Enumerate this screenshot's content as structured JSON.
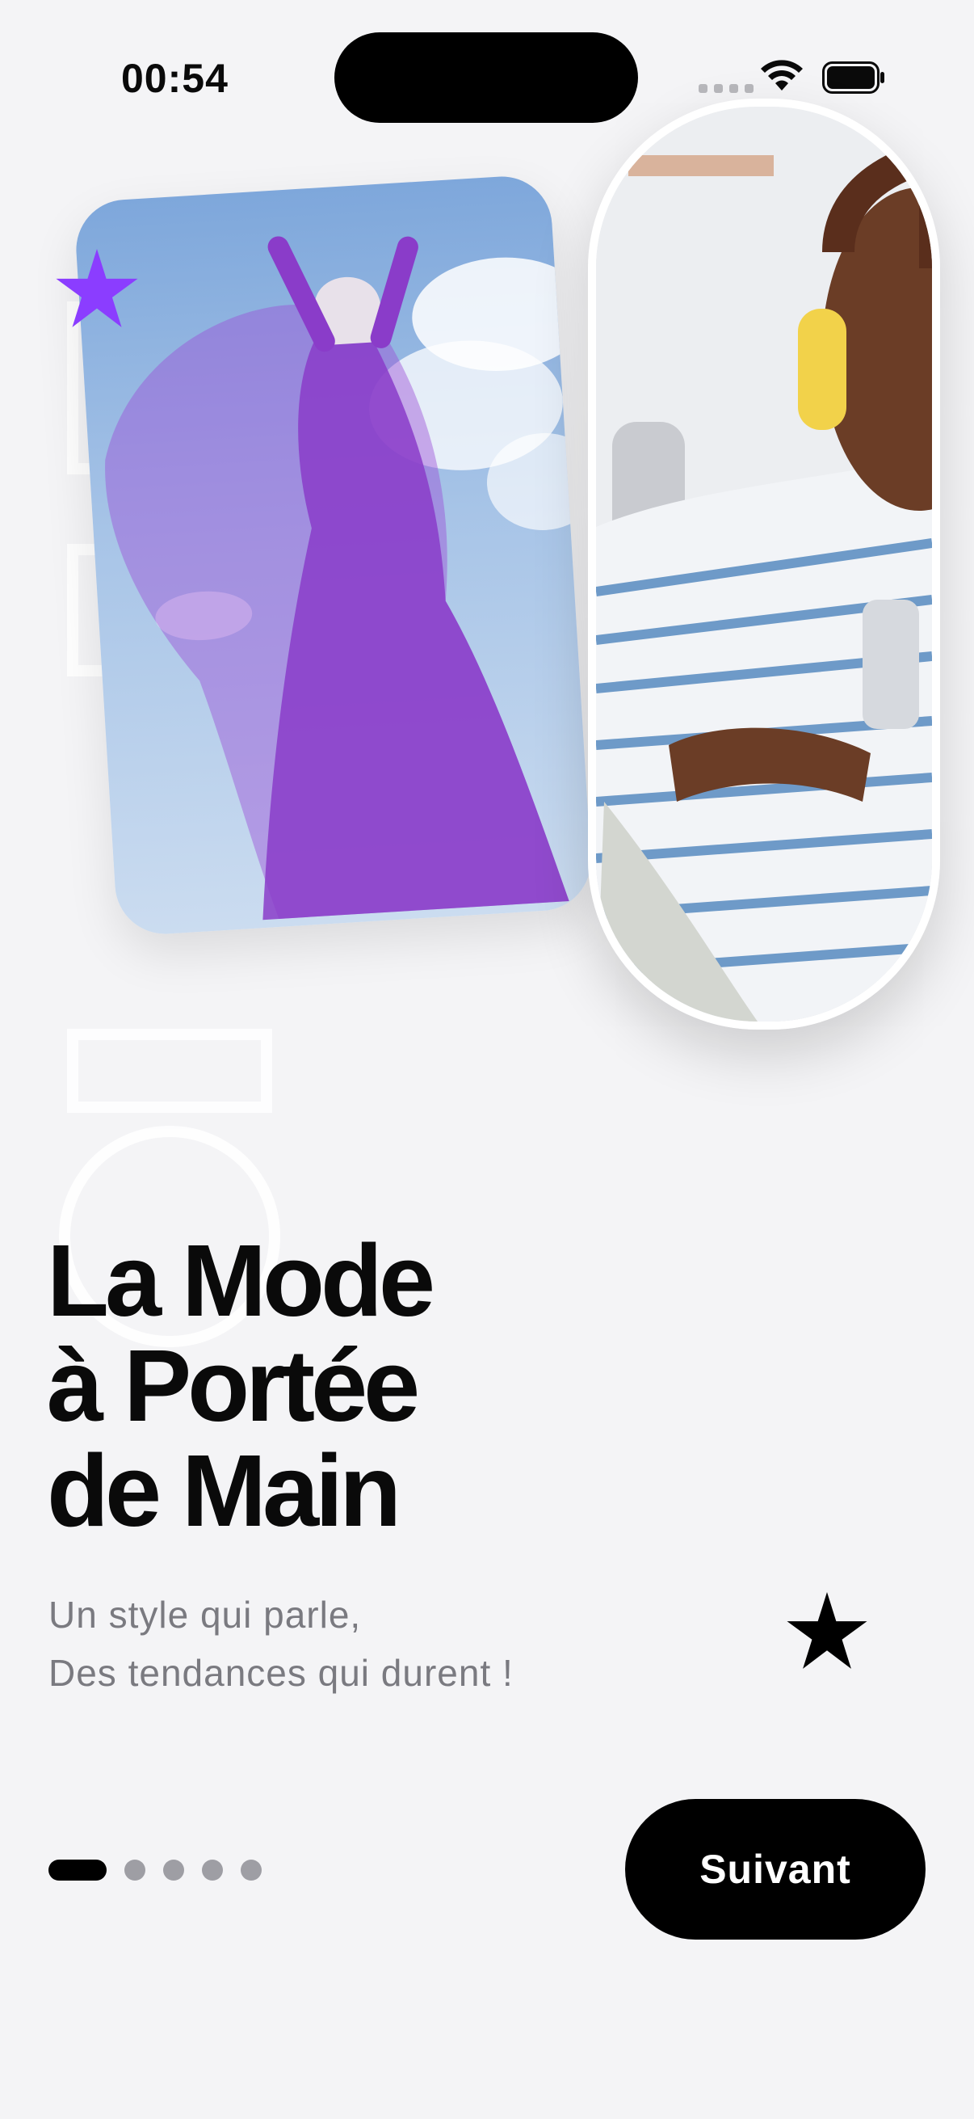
{
  "status_bar": {
    "time": "00:54",
    "icons": [
      "cellular-signal-icon",
      "wifi-icon",
      "battery-icon"
    ]
  },
  "hero": {
    "images": [
      {
        "name": "woman-purple-dress-photo"
      },
      {
        "name": "woman-headphones-phone-photo"
      }
    ],
    "decorations": [
      "star-icon",
      "star-icon"
    ]
  },
  "headline": {
    "line1": "La Mode",
    "line2": "à Portée",
    "line3": "de Main"
  },
  "subtitle": {
    "line1": "Un style qui parle,",
    "line2": "Des tendances qui durent !"
  },
  "pager": {
    "total": 5,
    "current": 1
  },
  "actions": {
    "next_label": "Suivant"
  },
  "colors": {
    "background": "#f4f4f6",
    "accent": "#8b3dff",
    "primary": "#000000",
    "muted_text": "#7a7a80"
  }
}
